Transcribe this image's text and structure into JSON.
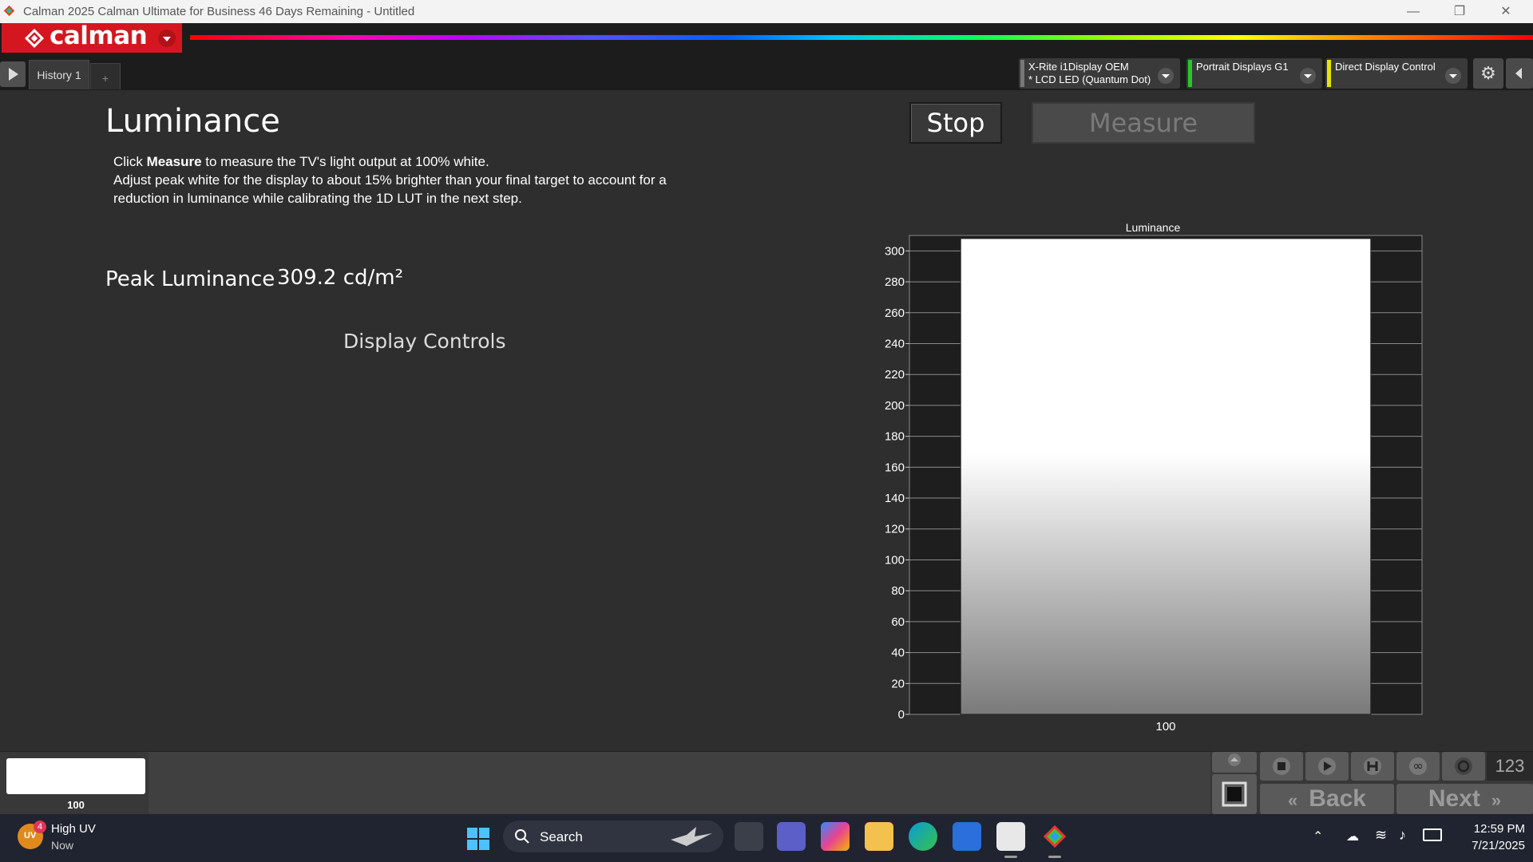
{
  "window": {
    "title": "Calman 2025 Calman Ultimate for Business 46 Days Remaining  - Untitled",
    "controls": {
      "minimize": "—",
      "restore": "❐",
      "close": "✕"
    }
  },
  "app": {
    "logo_text": "calman",
    "brand_color": "#d4171f",
    "tabs": [
      {
        "label": "History 1"
      }
    ],
    "add_tab_label": "+",
    "devices": [
      {
        "line1": "X-Rite i1Display OEM",
        "line2": "* LCD LED (Quantum Dot)",
        "bar_color": "#777777"
      },
      {
        "line1": "Portrait Displays G1",
        "line2": "",
        "bar_color": "#22cc22"
      },
      {
        "line1": "Direct Display Control",
        "line2": "",
        "bar_color": "#e5e500"
      }
    ]
  },
  "main": {
    "title": "Luminance",
    "instructions": {
      "line1_prefix": "Click ",
      "line1_bold": "Measure",
      "line1_suffix": " to measure the TV's light output at 100% white.",
      "line2": "Adjust peak white for the display to about 15% brighter than your final target to account for a reduction in luminance while calibrating the 1D LUT in the next step."
    },
    "stop_label": "Stop",
    "measure_label": "Measure",
    "peak_label": "Peak Luminance",
    "peak_value": "309.2 cd/m²",
    "display_controls_label": "Display Controls"
  },
  "chart_data": {
    "type": "bar",
    "title": "Luminance",
    "categories": [
      "100"
    ],
    "values": [
      308
    ],
    "ylim": [
      0,
      310
    ],
    "yticks": [
      0,
      20,
      40,
      60,
      80,
      100,
      120,
      140,
      160,
      180,
      200,
      220,
      240,
      260,
      280,
      300
    ],
    "grid": true,
    "xlabel": "",
    "ylabel": ""
  },
  "bottom": {
    "swatch_label": "100",
    "counter_label": "123",
    "back_label": "Back",
    "next_label": "Next"
  },
  "taskbar": {
    "weather_title": "High UV",
    "weather_sub": "Now",
    "weather_badge": "4",
    "weather_icon_text": "UV",
    "search_placeholder": "Search",
    "time": "12:59 PM",
    "date": "7/21/2025"
  }
}
